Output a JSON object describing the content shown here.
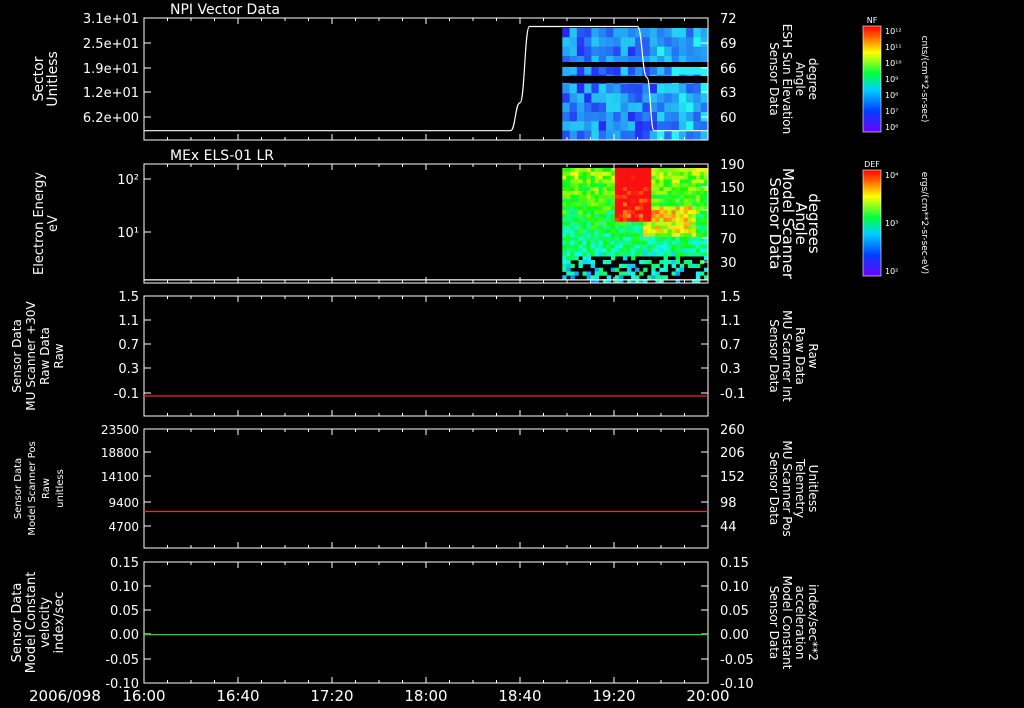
{
  "date_label": "2006/098",
  "colors": {
    "white": "#ffffff",
    "red": "#ff2020",
    "green": "#22dd22",
    "black": "#000000"
  },
  "chart_data": [
    {
      "type": "heatmap",
      "title": "NPI Vector Data",
      "ylabel_left": [
        "Sector",
        "Unitless"
      ],
      "yticks_left": [
        "3.1e+01",
        "2.5e+01",
        "1.9e+01",
        "1.2e+01",
        "6.2e+00"
      ],
      "ylabel_right": [
        "Sensor Data",
        "ESH Sun Elevation",
        "Angle",
        "degree"
      ],
      "yticks_right": [
        "72",
        "69",
        "66",
        "63",
        "60"
      ],
      "right_ylim": [
        57.6,
        72
      ],
      "line_series": {
        "name": "ESH Sun Elevation Angle",
        "color": "#ffffff",
        "x": [
          "16:00",
          "18:36",
          "18:40",
          "18:44",
          "19:30",
          "19:34",
          "19:37",
          "20:00"
        ],
        "y": [
          58.7,
          58.7,
          62.0,
          71.0,
          71.0,
          65.0,
          58.7,
          58.7
        ]
      },
      "heatmap_range": [
        "18:58",
        "20:00"
      ],
      "colorbar": {
        "label": "NF",
        "units": "cnts/(cm**2-sr-sec)",
        "ticks": [
          "10¹²",
          "10¹¹",
          "10¹⁰",
          "10⁹",
          "10⁸",
          "10⁷",
          "10⁶"
        ]
      }
    },
    {
      "type": "heatmap",
      "title": "MEx ELS-01 LR",
      "ylabel_left": [
        "Electron Energy",
        "eV"
      ],
      "yticks_left": [
        "10²",
        "10¹"
      ],
      "ylabel_right": [
        "Sensor Data",
        "Model Scanner",
        "Angle",
        "degrees"
      ],
      "yticks_right": [
        "190",
        "150",
        "110",
        "70",
        "30"
      ],
      "right_ylim": [
        0,
        190
      ],
      "line_series": {
        "name": "Model Scanner Angle",
        "color": "#ffffff",
        "x": [
          "16:00",
          "20:00"
        ],
        "y": [
          5,
          5
        ]
      },
      "heatmap_range": [
        "18:58",
        "20:00"
      ],
      "colorbar": {
        "label": "DEF",
        "units": "ergs/(cm**2-sr-sec-eV)",
        "ticks": [
          "10⁴",
          "10³",
          "10²"
        ]
      }
    },
    {
      "type": "line",
      "ylabel_left": [
        "Sensor Data",
        "MU Scanner +30V",
        "Raw Data",
        "Raw"
      ],
      "yticks_left": [
        "1.5",
        "1.1",
        "0.7",
        "0.3",
        "-0.1"
      ],
      "ylabel_right": [
        "Sensor Data",
        "MU Scanner Int",
        "Raw Data",
        "Raw"
      ],
      "yticks_right": [
        "1.5",
        "1.1",
        "0.7",
        "0.3",
        "-0.1"
      ],
      "ylim": [
        -0.3,
        1.5
      ],
      "series": [
        {
          "name": "MU Scanner +30V",
          "color": "#ff2020",
          "x": [
            "16:00",
            "20:00"
          ],
          "y": [
            0.0,
            0.0
          ]
        }
      ]
    },
    {
      "type": "line",
      "ylabel_left": [
        "Sensor Data",
        "Model Scanner Pos",
        "Raw",
        "unitless"
      ],
      "yticks_left": [
        "23500",
        "18800",
        "14100",
        "9400",
        "4700"
      ],
      "ylabel_right": [
        "Sensor Data",
        "MU Scanner Pos",
        "Telemetry",
        "Unitless"
      ],
      "yticks_right": [
        "260",
        "206",
        "152",
        "98",
        "44"
      ],
      "ylim": [
        0,
        23500
      ],
      "series": [
        {
          "name": "Model Scanner Pos",
          "color": "#ff2020",
          "x": [
            "16:00",
            "20:00"
          ],
          "y": [
            7200,
            7200
          ]
        }
      ]
    },
    {
      "type": "line",
      "ylabel_left": [
        "Sensor Data",
        "Model Constant",
        "velocity",
        "index/sec"
      ],
      "yticks_left": [
        "0.15",
        "0.10",
        "0.05",
        "0.00",
        "-0.05",
        "-0.10"
      ],
      "ylabel_right": [
        "Sensor Data",
        "Model Constant",
        "acceleration",
        "index/sec**2"
      ],
      "yticks_right": [
        "0.15",
        "0.10",
        "0.05",
        "0.00",
        "-0.05",
        "-0.10"
      ],
      "ylim": [
        -0.1,
        0.15
      ],
      "series": [
        {
          "name": "Model Constant velocity",
          "color": "#22dd22",
          "x": [
            "16:00",
            "20:00"
          ],
          "y": [
            0.0,
            0.0
          ]
        }
      ]
    }
  ],
  "x_axis": {
    "tick_labels": [
      "16:00",
      "16:40",
      "17:20",
      "18:00",
      "18:40",
      "19:20",
      "20:00"
    ]
  }
}
